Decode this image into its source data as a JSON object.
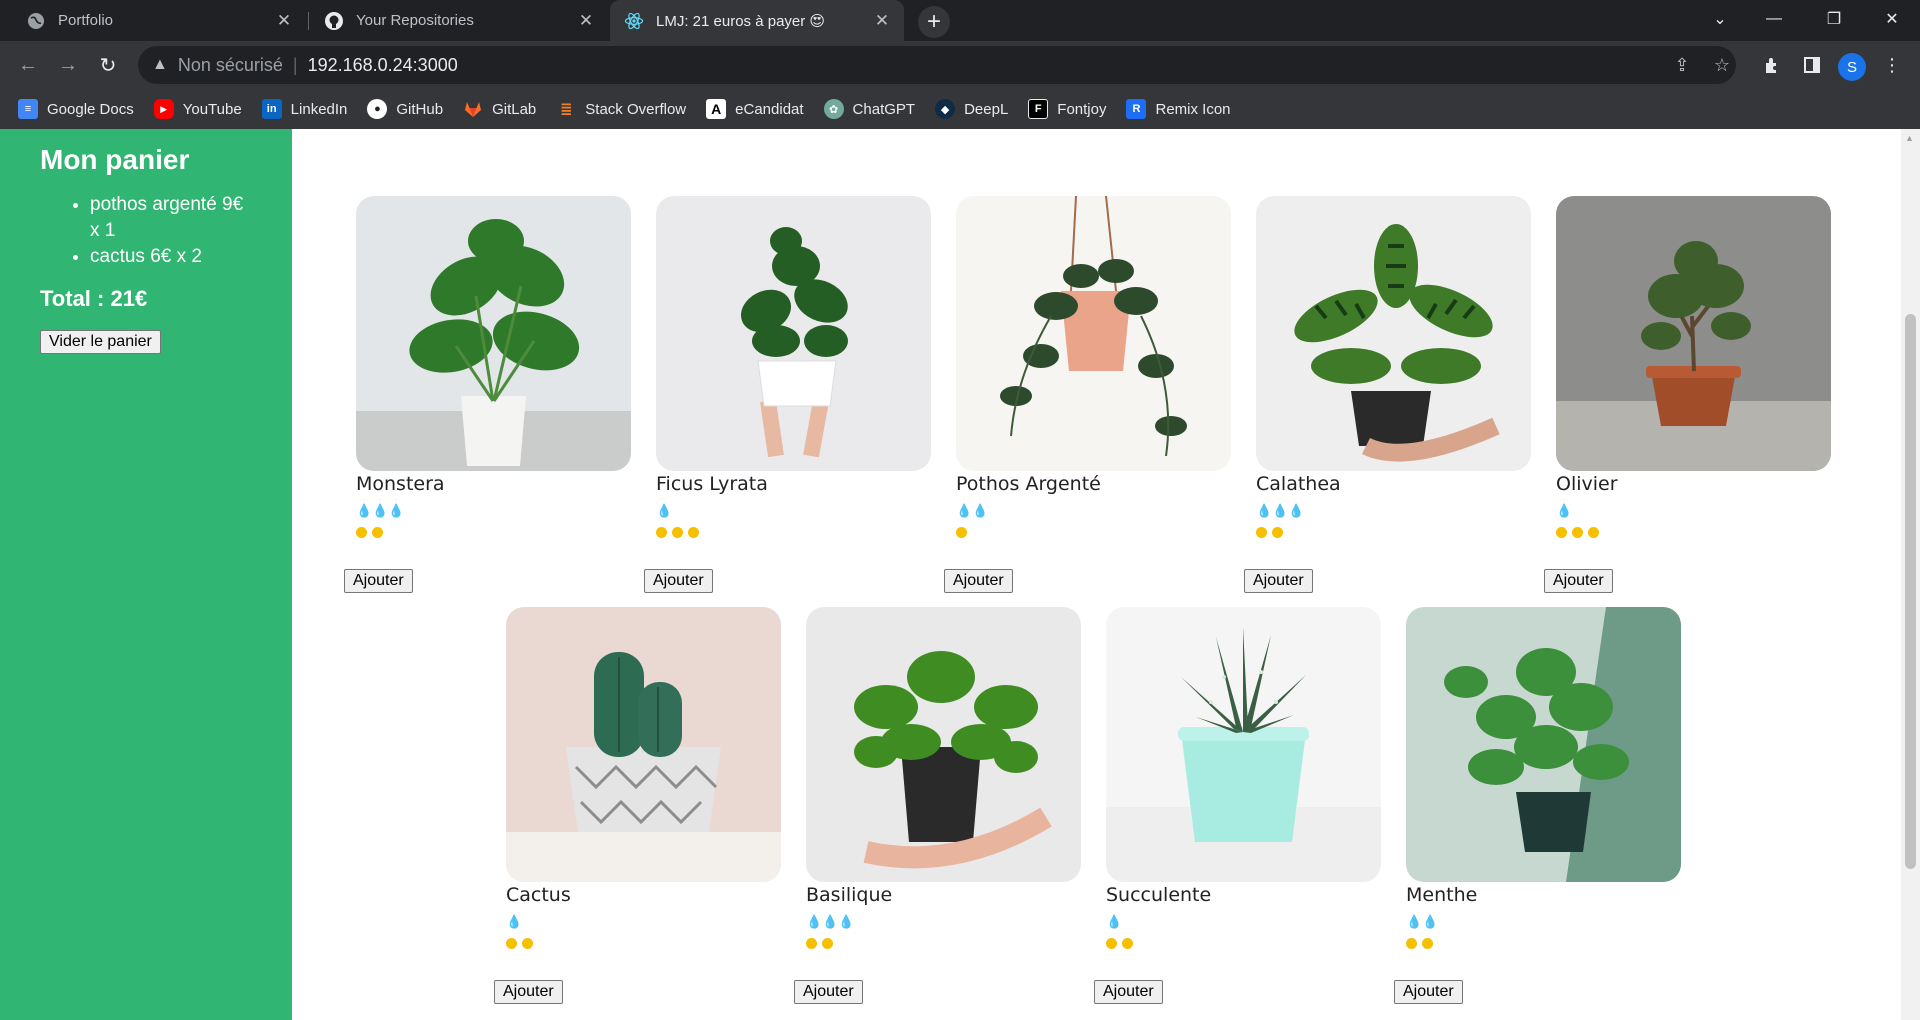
{
  "tabs": [
    {
      "label": "Portfolio",
      "icon": "globe-icon",
      "active": false
    },
    {
      "label": "Your Repositories",
      "icon": "github-icon",
      "active": false
    },
    {
      "label": "LMJ: 21 euros à payer 😍",
      "icon": "react-icon",
      "active": true
    }
  ],
  "toolbar": {
    "security_label": "Non sécurisé",
    "url": "192.168.0.24:3000",
    "profile_initial": "S"
  },
  "bookmarks": [
    {
      "label": "Google Docs",
      "icon": "google-docs-icon",
      "color": "#4285f4"
    },
    {
      "label": "YouTube",
      "icon": "youtube-icon",
      "color": "#ff0000"
    },
    {
      "label": "LinkedIn",
      "icon": "linkedin-icon",
      "color": "#0a66c2"
    },
    {
      "label": "GitHub",
      "icon": "github-icon",
      "color": "#ffffff"
    },
    {
      "label": "GitLab",
      "icon": "gitlab-icon",
      "color": "#fc6d26"
    },
    {
      "label": "Stack Overflow",
      "icon": "stackoverflow-icon",
      "color": "#f48024"
    },
    {
      "label": "eCandidat",
      "icon": "ecandidat-icon",
      "color": "#ffffff"
    },
    {
      "label": "ChatGPT",
      "icon": "chatgpt-icon",
      "color": "#74aa9c"
    },
    {
      "label": "DeepL",
      "icon": "deepl-icon",
      "color": "#0f2b46"
    },
    {
      "label": "Fontjoy",
      "icon": "fontjoy-icon",
      "color": "#000000"
    },
    {
      "label": "Remix Icon",
      "icon": "remix-icon",
      "color": "#1e6ef4"
    }
  ],
  "cart": {
    "title": "Mon panier",
    "items": [
      "pothos argenté 9€ x 1",
      "cactus 6€ x 2"
    ],
    "total": "Total : 21€",
    "empty_button": "Vider le panier"
  },
  "plants": [
    {
      "name": "Monstera",
      "water": 3,
      "light": 2,
      "add_label": "Ajouter"
    },
    {
      "name": "Ficus Lyrata",
      "water": 1,
      "light": 3,
      "add_label": "Ajouter"
    },
    {
      "name": "Pothos Argenté",
      "water": 2,
      "light": 1,
      "add_label": "Ajouter"
    },
    {
      "name": "Calathea",
      "water": 3,
      "light": 2,
      "add_label": "Ajouter"
    },
    {
      "name": "Olivier",
      "water": 1,
      "light": 3,
      "add_label": "Ajouter"
    },
    {
      "name": "Cactus",
      "water": 1,
      "light": 2,
      "add_label": "Ajouter"
    },
    {
      "name": "Basilique",
      "water": 3,
      "light": 2,
      "add_label": "Ajouter"
    },
    {
      "name": "Succulente",
      "water": 1,
      "light": 2,
      "add_label": "Ajouter"
    },
    {
      "name": "Menthe",
      "water": 2,
      "light": 2,
      "add_label": "Ajouter"
    }
  ],
  "colors": {
    "sidebar_bg": "#31b572",
    "water_drop": "#4a9fe0",
    "sun": "#f5c000"
  }
}
